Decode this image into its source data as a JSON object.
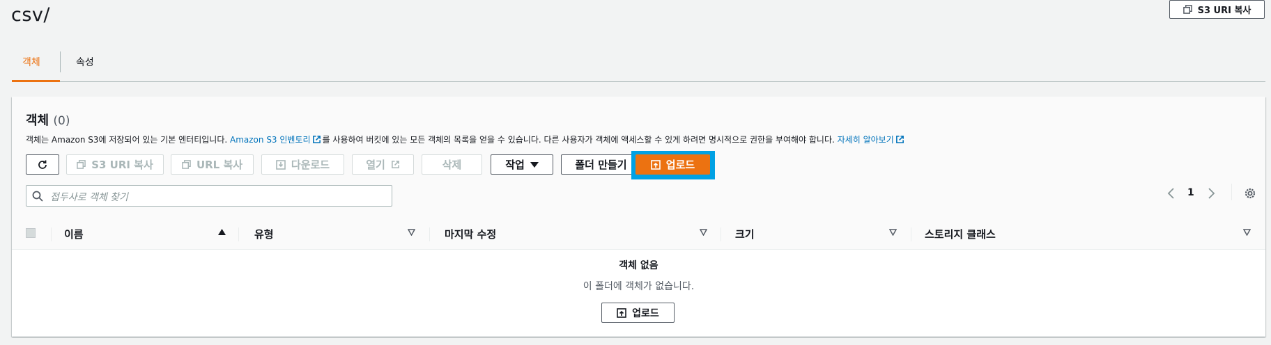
{
  "header": {
    "title": "csv/",
    "copy_s3_uri": "S3 URI 복사"
  },
  "tabs": [
    {
      "label": "객체",
      "active": true
    },
    {
      "label": "속성",
      "active": false
    }
  ],
  "panel": {
    "title": "객체",
    "count": "(0)",
    "description": {
      "part1": "객체는 Amazon S3에 저장되어 있는 기본 엔터티입니다. ",
      "link1": "Amazon S3 인벤토리",
      "part2": "를 사용하여 버킷에 있는 모든 객체의 목록을 얻을 수 있습니다. 다른 사용자가 객체에 액세스할 수 있게 하려면 명시적으로 권한을 부여해야 합니다. ",
      "link2": "자세히 알아보기"
    }
  },
  "toolbar": {
    "copy_s3_uri": "S3 URI 복사",
    "copy_url": "URL 복사",
    "download": "다운로드",
    "open": "열기",
    "delete": "삭제",
    "actions": "작업",
    "create_folder": "폴더 만들기",
    "upload": "업로드"
  },
  "search": {
    "placeholder": "접두사로 객체 찾기"
  },
  "pagination": {
    "current_page": "1"
  },
  "table": {
    "columns": [
      {
        "label": "이름",
        "sort": "ascending"
      },
      {
        "label": "유형",
        "sort": "none"
      },
      {
        "label": "마지막 수정",
        "sort": "none"
      },
      {
        "label": "크기",
        "sort": "none"
      },
      {
        "label": "스토리지 클래스",
        "sort": "none"
      }
    ],
    "empty_title": "객체 없음",
    "empty_message": "이 폴더에 객체가 없습니다.",
    "empty_upload": "업로드"
  },
  "colors": {
    "accent": "#ec7211",
    "focus": "#00a1e4",
    "link": "#0073bb"
  }
}
